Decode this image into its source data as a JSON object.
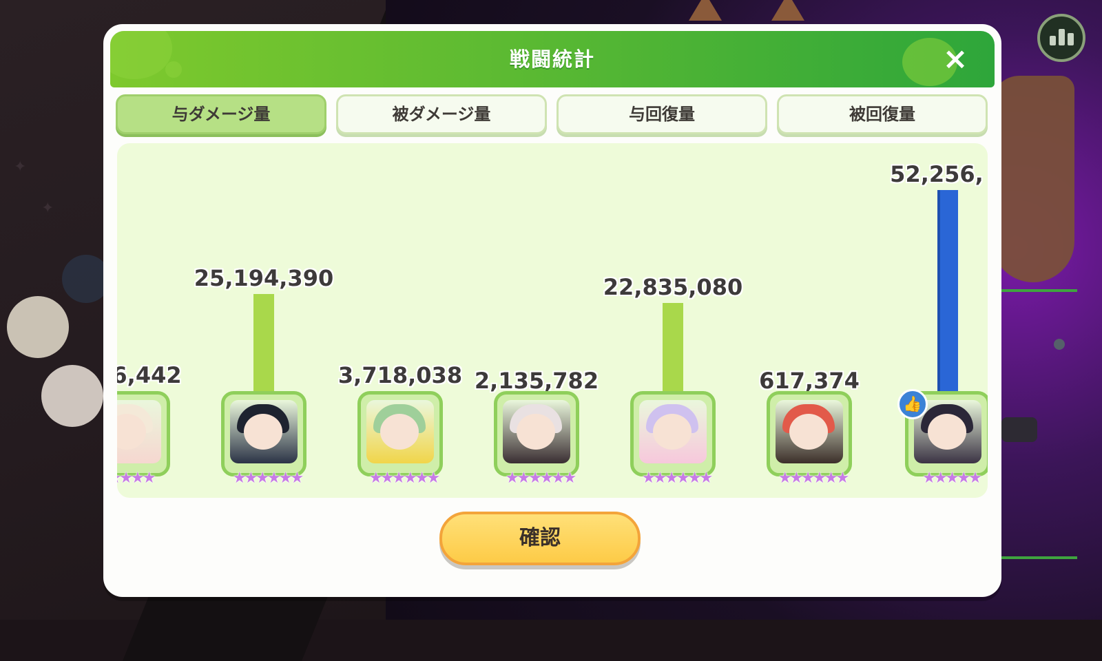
{
  "dialog": {
    "title": "戦闘統計",
    "close_icon": "×",
    "confirm_label": "確認"
  },
  "tabs": [
    {
      "label": "与ダメージ量",
      "active": true
    },
    {
      "label": "被ダメージ量",
      "active": false
    },
    {
      "label": "与回復量",
      "active": false
    },
    {
      "label": "被回復量",
      "active": false
    }
  ],
  "characters": [
    {
      "value_text": "6,442",
      "bar_fraction": 0,
      "highlight": false,
      "stars": "★★★★",
      "hair_color": "#f4e9d8",
      "outfit_color": "#f6d7d0"
    },
    {
      "value_text": "25,194,390",
      "bar_fraction": 0.482,
      "highlight": false,
      "stars": "★★★★★★",
      "hair_color": "#1e2330",
      "outfit_color": "#2b3346"
    },
    {
      "value_text": "3,718,038",
      "bar_fraction": 0,
      "highlight": false,
      "stars": "★★★★★★",
      "hair_color": "#9fcf9a",
      "outfit_color": "#f1d54a"
    },
    {
      "value_text": "2,135,782",
      "bar_fraction": 0,
      "highlight": false,
      "stars": "★★★★★★",
      "hair_color": "#e9e1e2",
      "outfit_color": "#3a2e32"
    },
    {
      "value_text": "22,835,080",
      "bar_fraction": 0.437,
      "highlight": false,
      "stars": "★★★★★★",
      "hair_color": "#cfc1ef",
      "outfit_color": "#f7c8dc"
    },
    {
      "value_text": "617,374",
      "bar_fraction": 0,
      "highlight": false,
      "stars": "★★★★★★",
      "hair_color": "#e25a4a",
      "outfit_color": "#3c2f2a"
    },
    {
      "value_text": "52,256,",
      "bar_fraction": 1,
      "highlight": true,
      "stars": "★★★★★",
      "hair_color": "#2b2738",
      "outfit_color": "#3b3344",
      "badge_icon": "👍"
    }
  ],
  "colors": {
    "header_green": "#4fb634",
    "bar_green": "#a9d84b",
    "bar_top_blue": "#2a66d6",
    "confirm_yellow": "#fdcb47"
  }
}
